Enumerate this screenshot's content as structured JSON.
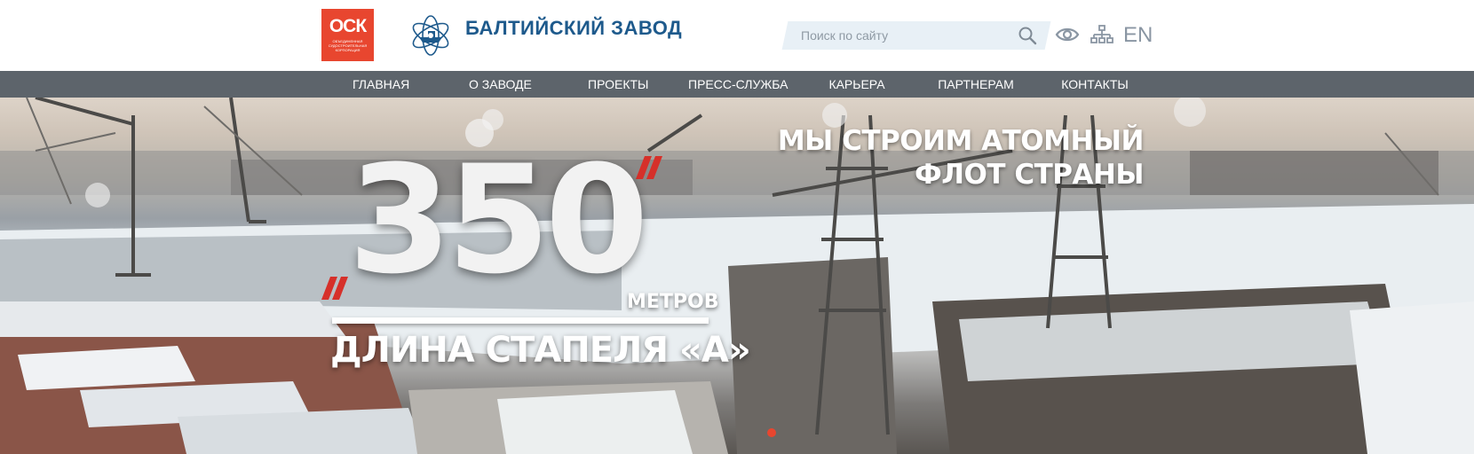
{
  "header": {
    "osk_logo": {
      "mark": "ОСК",
      "subtitle": "ОБЪЕДИНЕННАЯ СУДОСТРОИТЕЛЬНАЯ КОРПОРАЦИЯ"
    },
    "brand_name": "БАЛТИЙСКИЙ ЗАВОД",
    "search": {
      "placeholder": "Поиск по сайту",
      "value": ""
    },
    "lang_link": "EN",
    "icons": [
      "search-icon",
      "eye-icon",
      "sitemap-icon"
    ]
  },
  "nav": {
    "items": [
      {
        "label": "ГЛАВНАЯ"
      },
      {
        "label": "О ЗАВОДЕ"
      },
      {
        "label": "ПРОЕКТЫ"
      },
      {
        "label": "ПРЕСС-СЛУЖБА"
      },
      {
        "label": "КАРЬЕРА"
      },
      {
        "label": "ПАРТНЕРАМ"
      },
      {
        "label": "КОНТАКТЫ"
      }
    ]
  },
  "hero": {
    "slogan_line1": "МЫ СТРОИМ АТОМНЫЙ",
    "slogan_line2": "ФЛОТ СТРАНЫ",
    "big_number": "350",
    "unit": "МЕТРОВ",
    "caption": "ДЛИНА СТАПЕЛЯ «А»",
    "slides_shown": 1,
    "active_slide": 1
  },
  "colors": {
    "brand_red": "#e8462f",
    "brand_blue": "#1e5a8c",
    "nav_bg": "#5d646b",
    "search_bg": "#e8f0f6"
  }
}
